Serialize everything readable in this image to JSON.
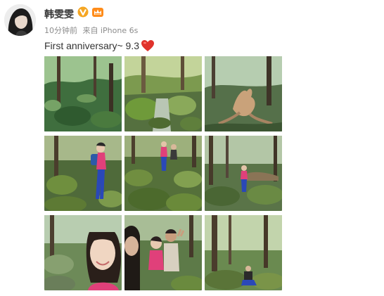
{
  "post": {
    "author": {
      "name": "韩雯雯",
      "verified_icon": "vip-v-icon",
      "member_icon": "member-crown-icon"
    },
    "meta": {
      "time": "10分钟前",
      "source": "来自 iPhone 6s"
    },
    "text": "First anniversary~ 9.3",
    "emoji": "heart-icon",
    "photos": [
      {
        "id": "photo-1",
        "scene": "forest-moss"
      },
      {
        "id": "photo-2",
        "scene": "stream-rocks"
      },
      {
        "id": "photo-3",
        "scene": "twisted-roots"
      },
      {
        "id": "photo-4",
        "scene": "hiker-woman"
      },
      {
        "id": "photo-5",
        "scene": "hikers-rocks"
      },
      {
        "id": "photo-6",
        "scene": "hiker-forest"
      },
      {
        "id": "photo-7",
        "scene": "selfie-woman"
      },
      {
        "id": "photo-8",
        "scene": "couple-selfie"
      },
      {
        "id": "photo-9",
        "scene": "man-sitting"
      }
    ],
    "colors": {
      "username": "#333333",
      "meta": "#8c8c8c",
      "vip_badge": "#f0a020",
      "heart": "#e0322b"
    }
  }
}
